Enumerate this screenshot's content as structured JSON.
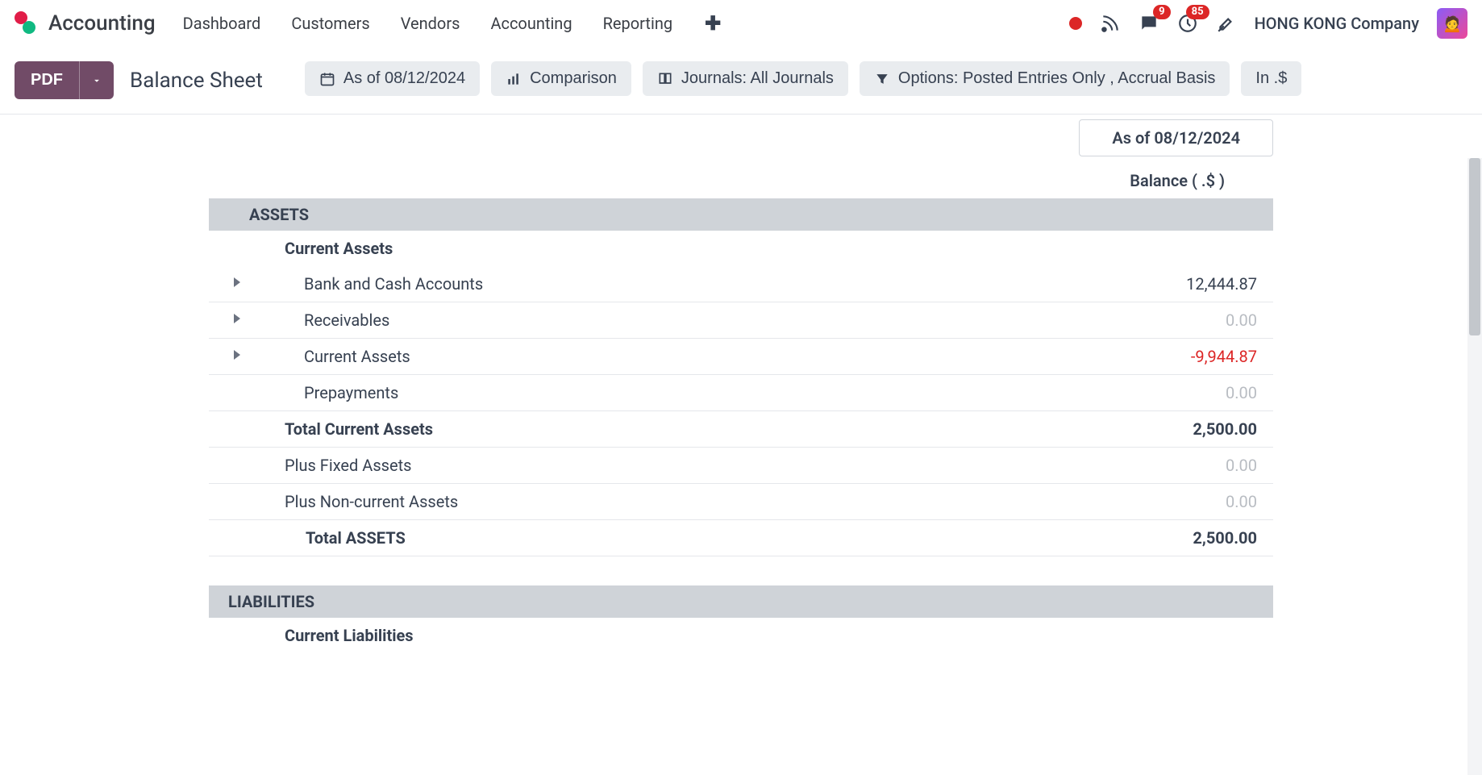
{
  "header": {
    "brand": "Accounting",
    "nav": [
      "Dashboard",
      "Customers",
      "Vendors",
      "Accounting",
      "Reporting"
    ],
    "messages_badge": "9",
    "activities_badge": "85",
    "company": "HONG KONG Company"
  },
  "controls": {
    "pdf_label": "PDF",
    "page_title": "Balance Sheet",
    "filter_date": "As of 08/12/2024",
    "filter_comparison": "Comparison",
    "filter_journals": "Journals: All Journals",
    "filter_options": "Options: Posted Entries Only , Accrual Basis",
    "filter_currency": "In .$"
  },
  "report": {
    "date_header": "As of 08/12/2024",
    "balance_label": "Balance ( .$ )",
    "sections": {
      "assets": {
        "title": "ASSETS",
        "current_assets_label": "Current Assets",
        "rows": {
          "bank": {
            "label": "Bank and Cash Accounts",
            "value": "12,444.87"
          },
          "receivables": {
            "label": "Receivables",
            "value": "0.00"
          },
          "current_assets": {
            "label": "Current Assets",
            "value": "-9,944.87"
          },
          "prepayments": {
            "label": "Prepayments",
            "value": "0.00"
          }
        },
        "total_current": {
          "label": "Total Current Assets",
          "value": "2,500.00"
        },
        "plus_fixed": {
          "label": "Plus Fixed Assets",
          "value": "0.00"
        },
        "plus_noncurrent": {
          "label": "Plus Non-current Assets",
          "value": "0.00"
        },
        "total_assets": {
          "label": "Total ASSETS",
          "value": "2,500.00"
        }
      },
      "liabilities": {
        "title": "LIABILITIES",
        "current_liabilities_label": "Current Liabilities"
      }
    }
  }
}
